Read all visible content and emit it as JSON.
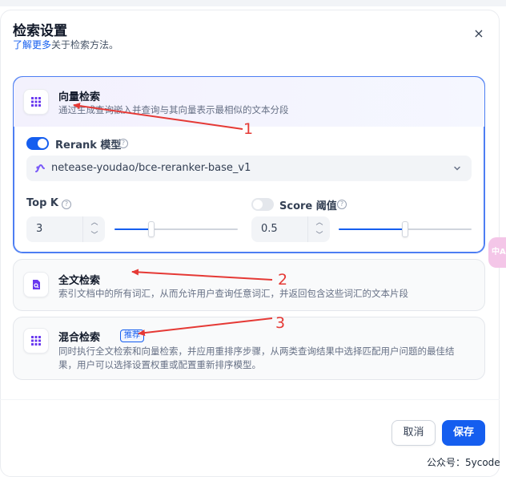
{
  "dialog": {
    "title": "检索设置",
    "subtitle_link": "了解更多",
    "subtitle_rest": "关于检索方法。",
    "close_glyph": "×"
  },
  "vector_search": {
    "title": "向量检索",
    "description": "通过生成查询嵌入并查询与其向量表示最相似的文本分段",
    "rerank_label": "Rerank 模型",
    "rerank_enabled": true,
    "rerank_model": "netease-youdao/bce-reranker-base_v1",
    "top_k_label": "Top K",
    "top_k_value": "3",
    "top_k_fill": 0.3,
    "score_label": "Score 阈值",
    "score_enabled": false,
    "score_value": "0.5",
    "score_fill": 0.5
  },
  "fulltext_search": {
    "title": "全文检索",
    "description": "索引文档中的所有词汇，从而允许用户查询任意词汇，并返回包含这些词汇的文本片段"
  },
  "hybrid_search": {
    "title": "混合检索",
    "badge": "推荐",
    "description_line1": "同时执行全文检索和向量检索，并应用重排序步骤，从两类查询结果中选择匹配用户问题的最佳结",
    "description_line2": "果，用户可以选择设置权重或配置重新排序模型。"
  },
  "footer": {
    "cancel": "取消",
    "save": "保存"
  },
  "watermark": "公众号：5ycode",
  "side_tab": "中A",
  "annotations": [
    "1",
    "2",
    "3"
  ],
  "colors": {
    "primary": "#155eef",
    "annotation_red": "#e53935",
    "active_border": "#4d7ef3"
  }
}
